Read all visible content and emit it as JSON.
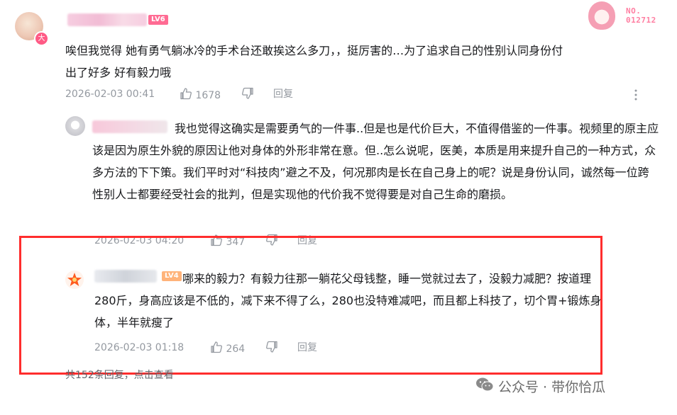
{
  "fan_badge": {
    "no_label": "NO.",
    "number": "012712"
  },
  "comment": {
    "level_badge": "LV6",
    "avatar_badge": "大",
    "content_lines": [
      "唉但我觉得 她有勇气躺冰冷的手术台还敢挨这么多刀，，挺厉害的…为了追求自己的性别认同身份付",
      "出了好多 好有毅力哦"
    ],
    "time": "2026-02-03 00:41",
    "likes": "1678",
    "reply_label": "回复"
  },
  "replies": [
    {
      "content": "我也觉得这确实是需要勇气的一件事..但是也是代价巨大，不值得借鉴的一件事。视频里的原主应该是因为原生外貌的原因让他对身体的外形非常在意。但..怎么说呢，医美，本质是用来提升自己的一种方式，众多方法的下下策。我们平时对“科技肉”避之不及，何况那肉是长在自己身上的呢？说是身份认同，诚然每一位跨性别人士都要经受社会的批判，但是实现他的代价我不觉得要是对自己生命的磨损。",
      "time": "2026-02-03 04:20",
      "likes": "347",
      "reply_label": "回复"
    },
    {
      "level_badge": "LV4",
      "content": "哪来的毅力？有毅力往那一躺花父母钱整，睡一觉就过去了，没毅力减肥？按道理280斤，身高应该是不低的，减下来不得了么，280也没特难减吧，而且都上科技了，切个胃+锻炼身体，半年就瘦了",
      "time": "2026-02-03 01:18",
      "likes": "264",
      "reply_label": "回复"
    }
  ],
  "total_replies": "共152条回复，点击查看",
  "watermark": {
    "text": "公众号 · 带你恰瓜"
  },
  "colors": {
    "highlight": "#ff2d2d",
    "meta_gray": "#9499a0",
    "lv6": "#ff6b93",
    "lv4": "#ffb37a"
  }
}
